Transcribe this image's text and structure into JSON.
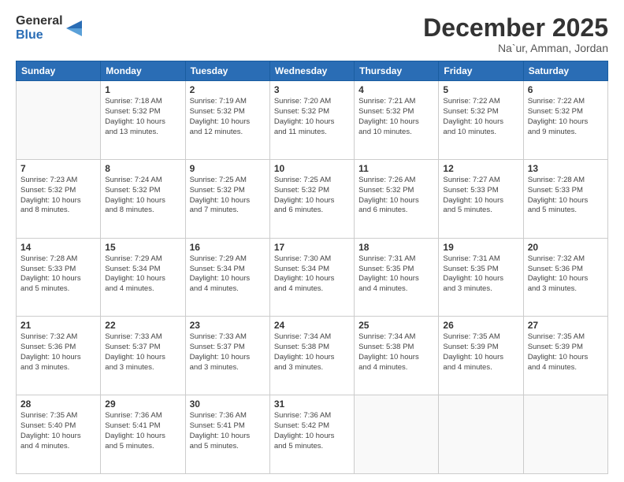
{
  "header": {
    "logo_line1": "General",
    "logo_line2": "Blue",
    "month": "December 2025",
    "location": "Na`ur, Amman, Jordan"
  },
  "days_of_week": [
    "Sunday",
    "Monday",
    "Tuesday",
    "Wednesday",
    "Thursday",
    "Friday",
    "Saturday"
  ],
  "weeks": [
    [
      {
        "day": "",
        "info": ""
      },
      {
        "day": "1",
        "info": "Sunrise: 7:18 AM\nSunset: 5:32 PM\nDaylight: 10 hours\nand 13 minutes."
      },
      {
        "day": "2",
        "info": "Sunrise: 7:19 AM\nSunset: 5:32 PM\nDaylight: 10 hours\nand 12 minutes."
      },
      {
        "day": "3",
        "info": "Sunrise: 7:20 AM\nSunset: 5:32 PM\nDaylight: 10 hours\nand 11 minutes."
      },
      {
        "day": "4",
        "info": "Sunrise: 7:21 AM\nSunset: 5:32 PM\nDaylight: 10 hours\nand 10 minutes."
      },
      {
        "day": "5",
        "info": "Sunrise: 7:22 AM\nSunset: 5:32 PM\nDaylight: 10 hours\nand 10 minutes."
      },
      {
        "day": "6",
        "info": "Sunrise: 7:22 AM\nSunset: 5:32 PM\nDaylight: 10 hours\nand 9 minutes."
      }
    ],
    [
      {
        "day": "7",
        "info": "Sunrise: 7:23 AM\nSunset: 5:32 PM\nDaylight: 10 hours\nand 8 minutes."
      },
      {
        "day": "8",
        "info": "Sunrise: 7:24 AM\nSunset: 5:32 PM\nDaylight: 10 hours\nand 8 minutes."
      },
      {
        "day": "9",
        "info": "Sunrise: 7:25 AM\nSunset: 5:32 PM\nDaylight: 10 hours\nand 7 minutes."
      },
      {
        "day": "10",
        "info": "Sunrise: 7:25 AM\nSunset: 5:32 PM\nDaylight: 10 hours\nand 6 minutes."
      },
      {
        "day": "11",
        "info": "Sunrise: 7:26 AM\nSunset: 5:32 PM\nDaylight: 10 hours\nand 6 minutes."
      },
      {
        "day": "12",
        "info": "Sunrise: 7:27 AM\nSunset: 5:33 PM\nDaylight: 10 hours\nand 5 minutes."
      },
      {
        "day": "13",
        "info": "Sunrise: 7:28 AM\nSunset: 5:33 PM\nDaylight: 10 hours\nand 5 minutes."
      }
    ],
    [
      {
        "day": "14",
        "info": "Sunrise: 7:28 AM\nSunset: 5:33 PM\nDaylight: 10 hours\nand 5 minutes."
      },
      {
        "day": "15",
        "info": "Sunrise: 7:29 AM\nSunset: 5:34 PM\nDaylight: 10 hours\nand 4 minutes."
      },
      {
        "day": "16",
        "info": "Sunrise: 7:29 AM\nSunset: 5:34 PM\nDaylight: 10 hours\nand 4 minutes."
      },
      {
        "day": "17",
        "info": "Sunrise: 7:30 AM\nSunset: 5:34 PM\nDaylight: 10 hours\nand 4 minutes."
      },
      {
        "day": "18",
        "info": "Sunrise: 7:31 AM\nSunset: 5:35 PM\nDaylight: 10 hours\nand 4 minutes."
      },
      {
        "day": "19",
        "info": "Sunrise: 7:31 AM\nSunset: 5:35 PM\nDaylight: 10 hours\nand 3 minutes."
      },
      {
        "day": "20",
        "info": "Sunrise: 7:32 AM\nSunset: 5:36 PM\nDaylight: 10 hours\nand 3 minutes."
      }
    ],
    [
      {
        "day": "21",
        "info": "Sunrise: 7:32 AM\nSunset: 5:36 PM\nDaylight: 10 hours\nand 3 minutes."
      },
      {
        "day": "22",
        "info": "Sunrise: 7:33 AM\nSunset: 5:37 PM\nDaylight: 10 hours\nand 3 minutes."
      },
      {
        "day": "23",
        "info": "Sunrise: 7:33 AM\nSunset: 5:37 PM\nDaylight: 10 hours\nand 3 minutes."
      },
      {
        "day": "24",
        "info": "Sunrise: 7:34 AM\nSunset: 5:38 PM\nDaylight: 10 hours\nand 3 minutes."
      },
      {
        "day": "25",
        "info": "Sunrise: 7:34 AM\nSunset: 5:38 PM\nDaylight: 10 hours\nand 4 minutes."
      },
      {
        "day": "26",
        "info": "Sunrise: 7:35 AM\nSunset: 5:39 PM\nDaylight: 10 hours\nand 4 minutes."
      },
      {
        "day": "27",
        "info": "Sunrise: 7:35 AM\nSunset: 5:39 PM\nDaylight: 10 hours\nand 4 minutes."
      }
    ],
    [
      {
        "day": "28",
        "info": "Sunrise: 7:35 AM\nSunset: 5:40 PM\nDaylight: 10 hours\nand 4 minutes."
      },
      {
        "day": "29",
        "info": "Sunrise: 7:36 AM\nSunset: 5:41 PM\nDaylight: 10 hours\nand 5 minutes."
      },
      {
        "day": "30",
        "info": "Sunrise: 7:36 AM\nSunset: 5:41 PM\nDaylight: 10 hours\nand 5 minutes."
      },
      {
        "day": "31",
        "info": "Sunrise: 7:36 AM\nSunset: 5:42 PM\nDaylight: 10 hours\nand 5 minutes."
      },
      {
        "day": "",
        "info": ""
      },
      {
        "day": "",
        "info": ""
      },
      {
        "day": "",
        "info": ""
      }
    ]
  ]
}
